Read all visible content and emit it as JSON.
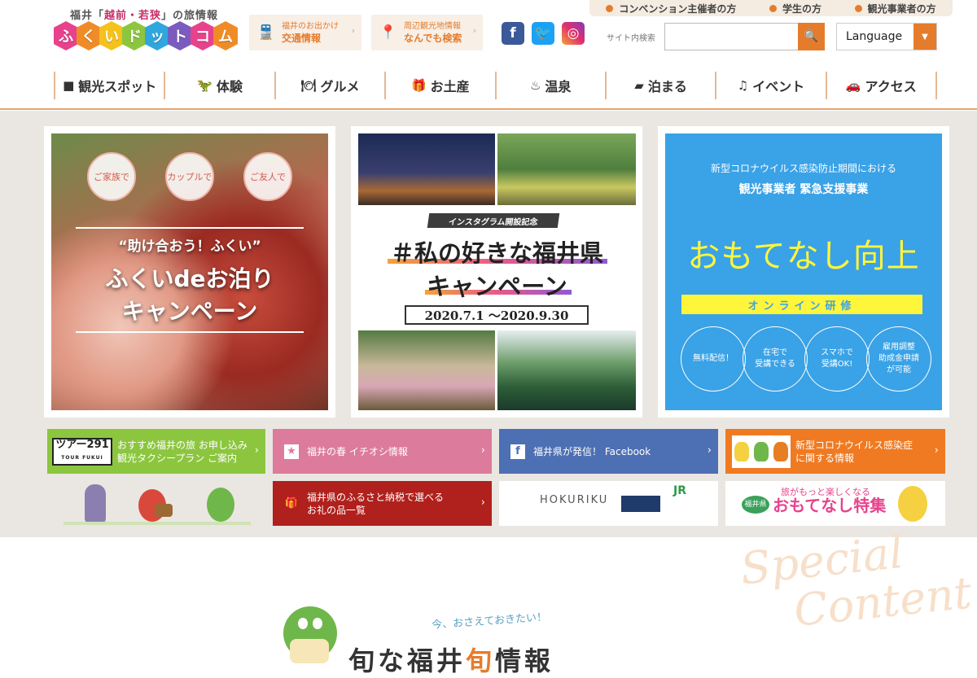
{
  "header": {
    "logo_sub_pre": "福井「",
    "logo_sub_hl": "越前・若狭",
    "logo_sub_post": "」の旅情報",
    "logo_chars": [
      "ふ",
      "く",
      "い",
      "ド",
      "ッ",
      "ト",
      "コ",
      "ム"
    ],
    "logo_colors": [
      "#e8428c",
      "#f08c28",
      "#f5c21b",
      "#8cc63f",
      "#2fa6de",
      "#7a5bbf",
      "#e8428c",
      "#f08c28"
    ],
    "traffic_btn": {
      "line1": "福井のお出かけ",
      "line2": "交通情報"
    },
    "search_btn": {
      "line1": "周辺観光地情報",
      "line2": "なんでも検索"
    },
    "top_links": [
      "コンベンション主催者の方",
      "学生の方",
      "観光事業者の方"
    ],
    "search_label": "サイト内検索",
    "search_value": "",
    "language_label": "Language",
    "social": [
      {
        "name": "facebook-icon",
        "glyph": "f",
        "color": "#3b5998"
      },
      {
        "name": "twitter-icon",
        "glyph": "t",
        "color": "#1da1f2"
      },
      {
        "name": "instagram-icon",
        "glyph": "◎",
        "color": "#c1358f"
      }
    ]
  },
  "nav": [
    {
      "label": "観光スポット",
      "icon": "■",
      "name": "camera-icon"
    },
    {
      "label": "体験",
      "icon": "🦖",
      "name": "dinosaur-icon"
    },
    {
      "label": "グルメ",
      "icon": "🍽",
      "name": "dish-icon"
    },
    {
      "label": "お土産",
      "icon": "🎁",
      "name": "gift-icon"
    },
    {
      "label": "温泉",
      "icon": "♨",
      "name": "hotspring-icon"
    },
    {
      "label": "泊まる",
      "icon": "▰",
      "name": "bed-icon"
    },
    {
      "label": "イベント",
      "icon": "♫",
      "name": "music-icon"
    },
    {
      "label": "アクセス",
      "icon": "🚗",
      "name": "car-icon"
    }
  ],
  "banners": {
    "b1": {
      "bubbles": [
        "ご家族で",
        "カップルで",
        "ご友人で"
      ],
      "quote": "“助け合おう！ふくい”",
      "line1": "ふくいdeお泊り",
      "line2": "キャンペーン"
    },
    "b2": {
      "tag": "インスタグラム開設記念",
      "line1": "＃私の好きな福井県",
      "line2": "キャンペーン",
      "date": "2020.7.1 〜2020.9.30"
    },
    "b3": {
      "sub1": "新型コロナウイルス感染防止期間における",
      "sub2": "観光事業者 緊急支援事業",
      "big": "おもてなし向上",
      "bar": "オンライン研修",
      "circles": [
        "無料配信！",
        "在宅で\n受講できる",
        "スマホで\n受講OK!",
        "雇用調整\n助成金申請\nが可能"
      ]
    }
  },
  "tiles": {
    "green": {
      "logo_main": "ツアー291",
      "logo_sub": "TOUR FUKUI",
      "text": "おすすめ福井の旅 お申し込み\n観光タクシープラン ご案内"
    },
    "pink": {
      "text": "福井の春 イチオシ情報"
    },
    "blue": {
      "text": "福井県が発信！ Facebook"
    },
    "orange": {
      "text": "新型コロナウイルス感染症\nに関する情報"
    },
    "red": {
      "text": "福井県のふるさと納税で選べる\nお礼の品一覧"
    },
    "hokuriku": {
      "text": "HOKURIKU",
      "jr": "JR"
    },
    "omotenashi": {
      "small": "旅がもっと楽しくなる",
      "pref": "福井県",
      "big": "おもてなし特集"
    }
  },
  "special": {
    "line1": "Special",
    "line2": "Content",
    "ima": "今、おさえておきたい！",
    "headline_pre": "旬な福井",
    "headline_hl": "旬",
    "headline_post": "情報"
  }
}
